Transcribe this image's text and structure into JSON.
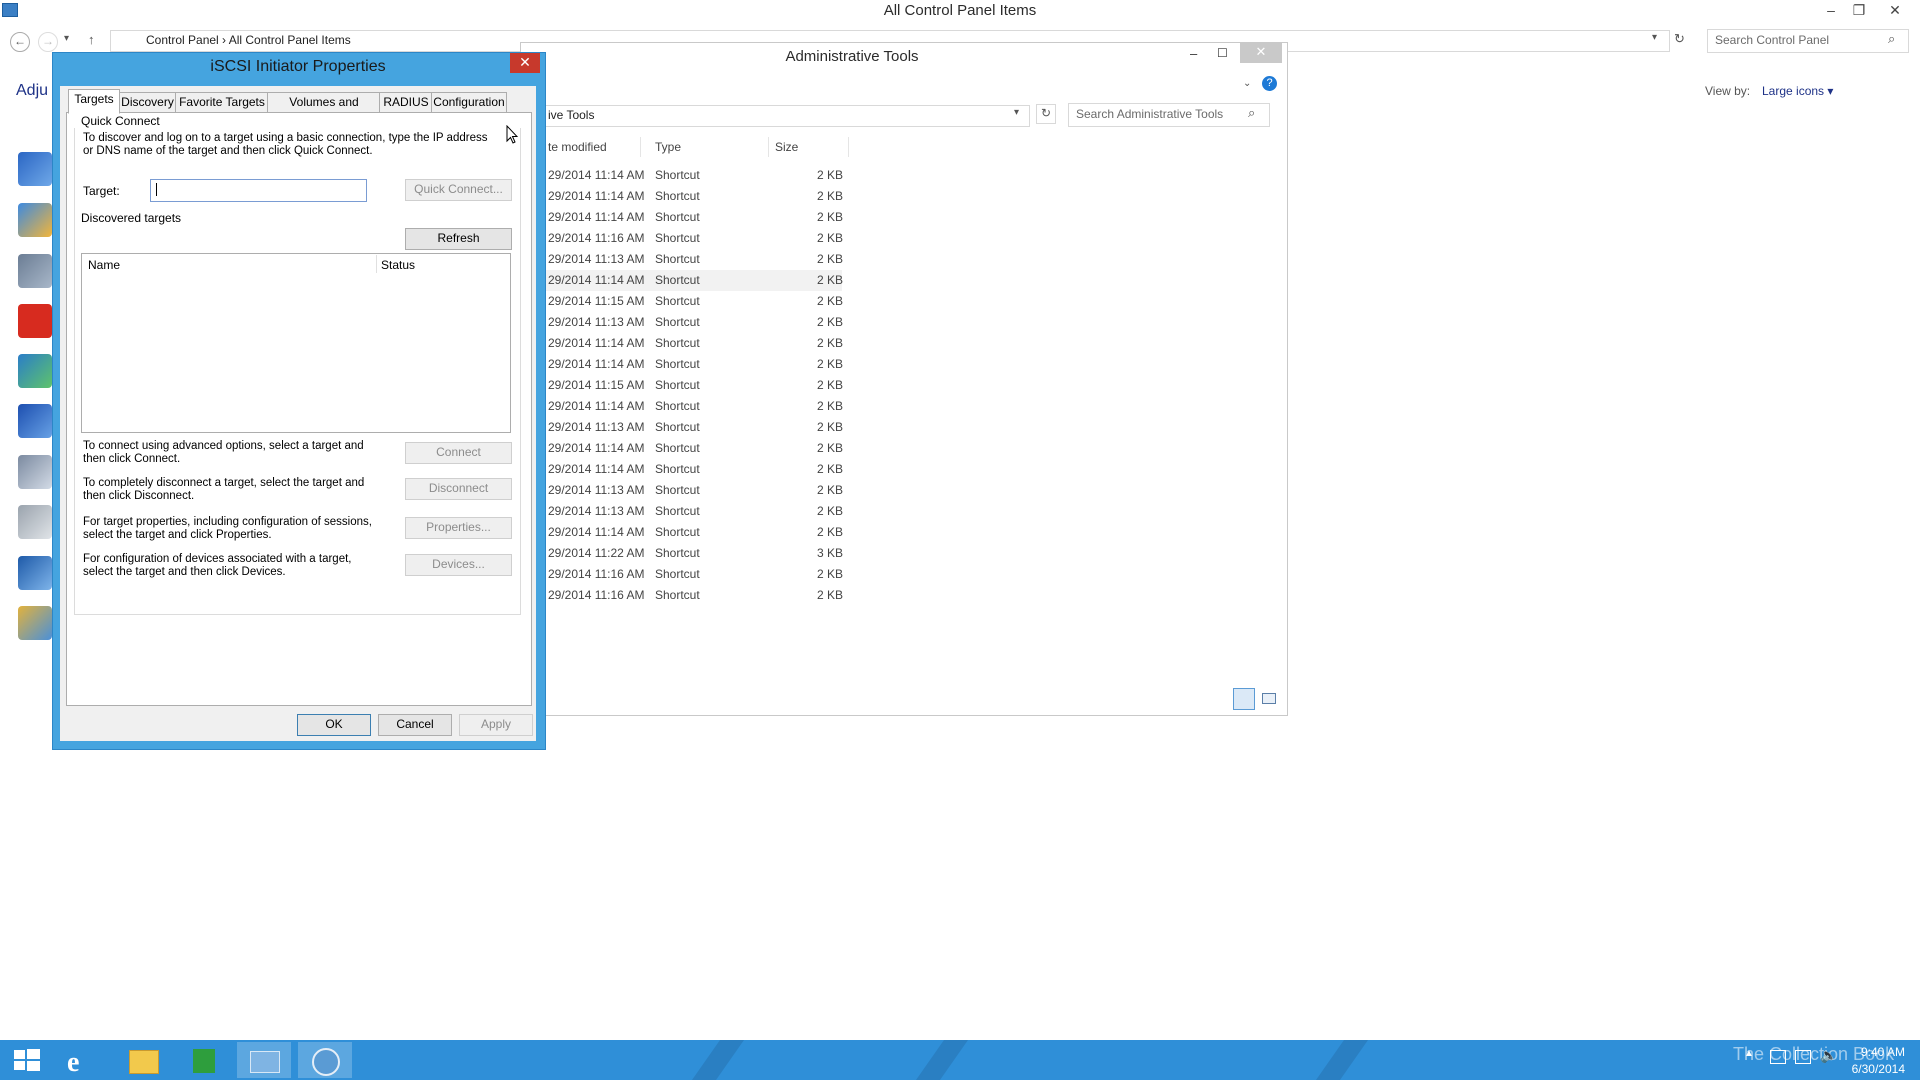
{
  "control_panel": {
    "title": "All Control Panel Items",
    "breadcrumb": [
      "Control Panel",
      "All Control Panel Items"
    ],
    "address_text": "Control Panel  ›  All Control Panel Items",
    "search_placeholder": "Search Control Panel",
    "adjust_text": "Adju",
    "view_by_label": "View by:",
    "view_by_value": "Large icons ▾"
  },
  "admin_tools": {
    "title": "Administrative Tools",
    "address_text": "ive Tools",
    "search_placeholder": "Search Administrative Tools",
    "columns": {
      "date": "te modified",
      "type": "Type",
      "size": "Size"
    },
    "rows": [
      {
        "date": "29/2014 11:14 AM",
        "type": "Shortcut",
        "size": "2 KB"
      },
      {
        "date": "29/2014 11:14 AM",
        "type": "Shortcut",
        "size": "2 KB"
      },
      {
        "date": "29/2014 11:14 AM",
        "type": "Shortcut",
        "size": "2 KB"
      },
      {
        "date": "29/2014 11:16 AM",
        "type": "Shortcut",
        "size": "2 KB"
      },
      {
        "date": "29/2014 11:13 AM",
        "type": "Shortcut",
        "size": "2 KB"
      },
      {
        "date": "29/2014 11:14 AM",
        "type": "Shortcut",
        "size": "2 KB"
      },
      {
        "date": "29/2014 11:15 AM",
        "type": "Shortcut",
        "size": "2 KB"
      },
      {
        "date": "29/2014 11:13 AM",
        "type": "Shortcut",
        "size": "2 KB"
      },
      {
        "date": "29/2014 11:14 AM",
        "type": "Shortcut",
        "size": "2 KB"
      },
      {
        "date": "29/2014 11:14 AM",
        "type": "Shortcut",
        "size": "2 KB"
      },
      {
        "date": "29/2014 11:15 AM",
        "type": "Shortcut",
        "size": "2 KB"
      },
      {
        "date": "29/2014 11:14 AM",
        "type": "Shortcut",
        "size": "2 KB"
      },
      {
        "date": "29/2014 11:13 AM",
        "type": "Shortcut",
        "size": "2 KB"
      },
      {
        "date": "29/2014 11:14 AM",
        "type": "Shortcut",
        "size": "2 KB"
      },
      {
        "date": "29/2014 11:14 AM",
        "type": "Shortcut",
        "size": "2 KB"
      },
      {
        "date": "29/2014 11:13 AM",
        "type": "Shortcut",
        "size": "2 KB"
      },
      {
        "date": "29/2014 11:13 AM",
        "type": "Shortcut",
        "size": "2 KB"
      },
      {
        "date": "29/2014 11:14 AM",
        "type": "Shortcut",
        "size": "2 KB"
      },
      {
        "date": "29/2014 11:22 AM",
        "type": "Shortcut",
        "size": "3 KB"
      },
      {
        "date": "29/2014 11:16 AM",
        "type": "Shortcut",
        "size": "2 KB"
      },
      {
        "date": "29/2014 11:16 AM",
        "type": "Shortcut",
        "size": "2 KB"
      }
    ]
  },
  "dialog": {
    "title": "iSCSI Initiator Properties",
    "close_glyph": "✕",
    "tabs": [
      "Targets",
      "Discovery",
      "Favorite Targets",
      "Volumes and Devices",
      "RADIUS",
      "Configuration"
    ],
    "quick_connect": {
      "group_label": "Quick Connect",
      "help": "To discover and log on to a target using a basic connection, type the IP address or DNS name of the target and then click Quick Connect.",
      "target_label": "Target:",
      "target_value": "",
      "button": "Quick Connect..."
    },
    "discovered": {
      "group_label": "Discovered targets",
      "refresh": "Refresh",
      "col_name": "Name",
      "col_status": "Status"
    },
    "actions": [
      {
        "help": "To connect using advanced options, select a target and then click Connect.",
        "button": "Connect"
      },
      {
        "help": "To completely disconnect a target, select the target and then click Disconnect.",
        "button": "Disconnect"
      },
      {
        "help": "For target properties, including configuration of sessions, select the target and click Properties.",
        "button": "Properties..."
      },
      {
        "help": "For configuration of devices associated with a target, select the target and then click Devices.",
        "button": "Devices..."
      }
    ],
    "ok": "OK",
    "cancel": "Cancel",
    "apply": "Apply"
  },
  "taskbar": {
    "time": "9:40 AM",
    "date": "6/30/2014",
    "watermark": "The Collection Book",
    "apps": [
      "start-icon",
      "internet-explorer-icon",
      "file-explorer-icon",
      "store-icon",
      "control-panel-icon",
      "iscsi-icon"
    ]
  },
  "colors": {
    "dialog_frame": "#45a4df",
    "taskbar": "#2f8fd8",
    "close_red": "#c7392c",
    "link_blue": "#1e3287"
  }
}
